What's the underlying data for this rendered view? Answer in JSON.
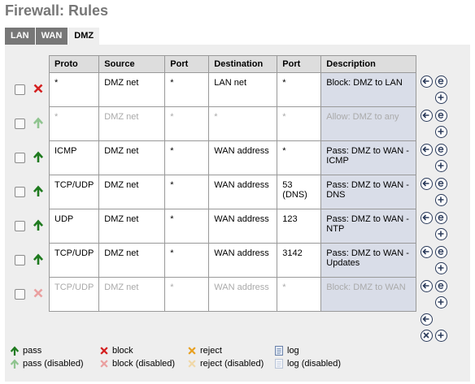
{
  "page": {
    "title": "Firewall: Rules"
  },
  "tabs": [
    {
      "label": "LAN",
      "active": false
    },
    {
      "label": "WAN",
      "active": false
    },
    {
      "label": "DMZ",
      "active": true
    }
  ],
  "table": {
    "headers": [
      "Proto",
      "Source",
      "Port",
      "Destination",
      "Port",
      "Description"
    ],
    "rows": [
      {
        "state": "block",
        "disabled": false,
        "proto": "*",
        "source": "DMZ net",
        "src_port": "*",
        "destination": "LAN net",
        "dst_port": "*",
        "description": "Block: DMZ to LAN"
      },
      {
        "state": "pass",
        "disabled": true,
        "proto": "*",
        "source": "DMZ net",
        "src_port": "*",
        "destination": "*",
        "dst_port": "*",
        "description": "Allow: DMZ to any"
      },
      {
        "state": "pass",
        "disabled": false,
        "proto": "ICMP",
        "source": "DMZ net",
        "src_port": "*",
        "destination": "WAN address",
        "dst_port": "*",
        "description": "Pass: DMZ to WAN - ICMP"
      },
      {
        "state": "pass",
        "disabled": false,
        "proto": "TCP/UDP",
        "source": "DMZ net",
        "src_port": "*",
        "destination": "WAN address",
        "dst_port": "53 (DNS)",
        "description": "Pass: DMZ to WAN - DNS"
      },
      {
        "state": "pass",
        "disabled": false,
        "proto": "UDP",
        "source": "DMZ net",
        "src_port": "*",
        "destination": "WAN address",
        "dst_port": "123",
        "description": "Pass: DMZ to WAN - NTP"
      },
      {
        "state": "pass",
        "disabled": false,
        "proto": "TCP/UDP",
        "source": "DMZ net",
        "src_port": "*",
        "destination": "WAN address",
        "dst_port": "3142",
        "description": "Pass: DMZ to WAN - Updates"
      },
      {
        "state": "block",
        "disabled": true,
        "proto": "TCP/UDP",
        "source": "DMZ net",
        "src_port": "*",
        "destination": "WAN address",
        "dst_port": "*",
        "description": "Block: DMZ to WAN"
      }
    ]
  },
  "legend": [
    {
      "icon": "pass-icon",
      "label": "pass"
    },
    {
      "icon": "block-icon",
      "label": "block"
    },
    {
      "icon": "reject-icon",
      "label": "reject"
    },
    {
      "icon": "log-icon",
      "label": "log"
    },
    {
      "icon": "pass-disabled-icon",
      "label": "pass (disabled)"
    },
    {
      "icon": "block-disabled-icon",
      "label": "block (disabled)"
    },
    {
      "icon": "reject-disabled-icon",
      "label": "reject (disabled)"
    },
    {
      "icon": "log-disabled-icon",
      "label": "log (disabled)"
    }
  ],
  "colors": {
    "pass": "#1e7a1e",
    "pass_disabled": "#8fc48f",
    "block": "#d42020",
    "block_disabled": "#eaa0a0",
    "reject": "#e8a020",
    "reject_disabled": "#f0d8a8",
    "description_bg": "#d9dde8",
    "panel_bg": "#eeeeee",
    "tab_bg": "#777777"
  }
}
